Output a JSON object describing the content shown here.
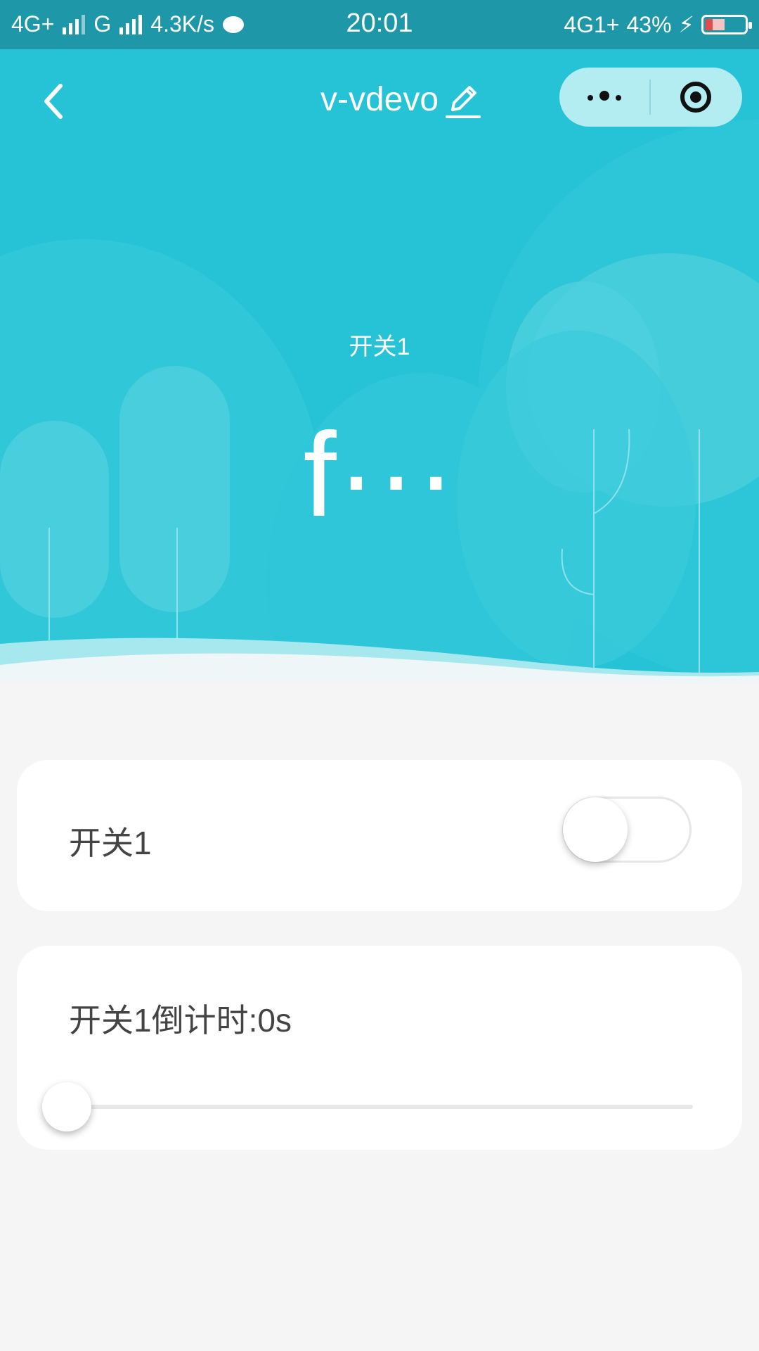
{
  "statusbar": {
    "network1": "4G+",
    "network2": "G",
    "speed": "4.3K/s",
    "time": "20:01",
    "network3": "4G1+",
    "battery": "43%",
    "battery_level_percent": 43
  },
  "navbar": {
    "title": "v-vdevo",
    "back_icon": "chevron-left-icon",
    "edit_icon": "pencil-icon",
    "more_icon": "more-dots-icon",
    "close_icon": "target-circle-icon"
  },
  "hero": {
    "label": "开关1",
    "value": "f···"
  },
  "switch_card": {
    "label": "开关1",
    "checked": false
  },
  "countdown_card": {
    "label": "开关1倒计时:0s",
    "slider_value_percent": 0
  },
  "colors": {
    "hero": "#26c3d6",
    "statusbar": "#1e98a8",
    "page_bg": "#f5f5f5"
  }
}
